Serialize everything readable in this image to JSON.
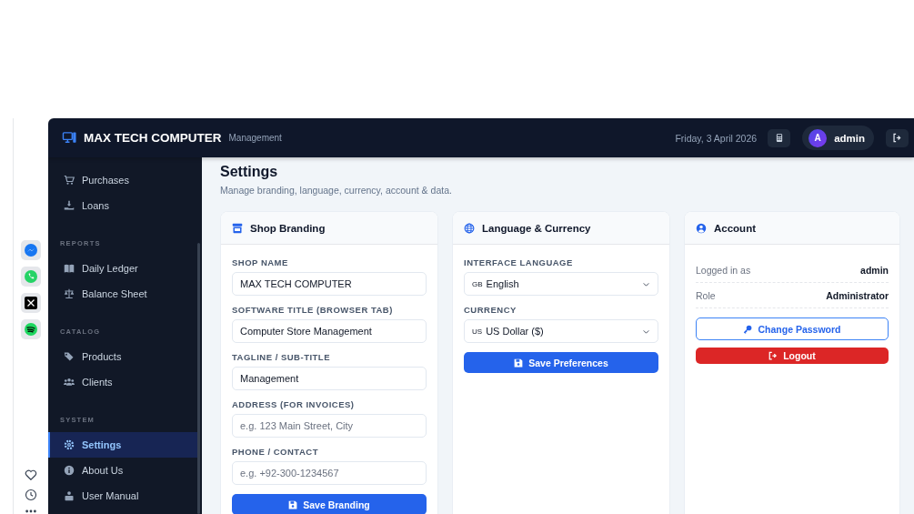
{
  "header": {
    "brand": "MAX TECH COMPUTER",
    "tagline": "Management",
    "date": "Friday, 3 April 2026",
    "user": {
      "initial": "A",
      "name": "admin"
    }
  },
  "sidebar": {
    "sections": [
      {
        "items": [
          {
            "label": "Purchases",
            "selected": false
          },
          {
            "label": "Loans",
            "selected": false
          }
        ]
      },
      {
        "label": "REPORTS",
        "items": [
          {
            "label": "Daily Ledger",
            "selected": false
          },
          {
            "label": "Balance Sheet",
            "selected": false
          }
        ]
      },
      {
        "label": "CATALOG",
        "items": [
          {
            "label": "Products",
            "selected": false
          },
          {
            "label": "Clients",
            "selected": false
          }
        ]
      },
      {
        "label": "SYSTEM",
        "items": [
          {
            "label": "Settings",
            "selected": true
          },
          {
            "label": "About Us",
            "selected": false
          },
          {
            "label": "User Manual",
            "selected": false
          }
        ]
      }
    ]
  },
  "page": {
    "title": "Settings",
    "subtitle": "Manage branding, language, currency, account & data."
  },
  "branding": {
    "title": "Shop Branding",
    "fields": [
      {
        "label": "SHOP NAME",
        "value": "MAX TECH COMPUTER"
      },
      {
        "label": "SOFTWARE TITLE (BROWSER TAB)",
        "value": "Computer Store Management"
      },
      {
        "label": "TAGLINE / SUB-TITLE",
        "value": "Management"
      },
      {
        "label": "ADDRESS (FOR INVOICES)",
        "placeholder": "e.g. 123 Main Street, City"
      },
      {
        "label": "PHONE / CONTACT",
        "placeholder": "e.g. +92-300-1234567"
      }
    ],
    "button": "Save Branding"
  },
  "language": {
    "title": "Language & Currency",
    "fields": [
      {
        "label": "INTERFACE LANGUAGE",
        "flag": "GB",
        "value": "English"
      },
      {
        "label": "CURRENCY",
        "flag": "US",
        "value": "US Dollar ($)"
      }
    ],
    "button": "Save Preferences"
  },
  "account": {
    "title": "Account",
    "rows": [
      {
        "label": "Logged in as",
        "value": "admin"
      },
      {
        "label": "Role",
        "value": "Administrator"
      }
    ],
    "buttons": [
      {
        "label": "Change Password",
        "kind": "outline"
      },
      {
        "label": "Logout",
        "kind": "danger"
      }
    ]
  }
}
